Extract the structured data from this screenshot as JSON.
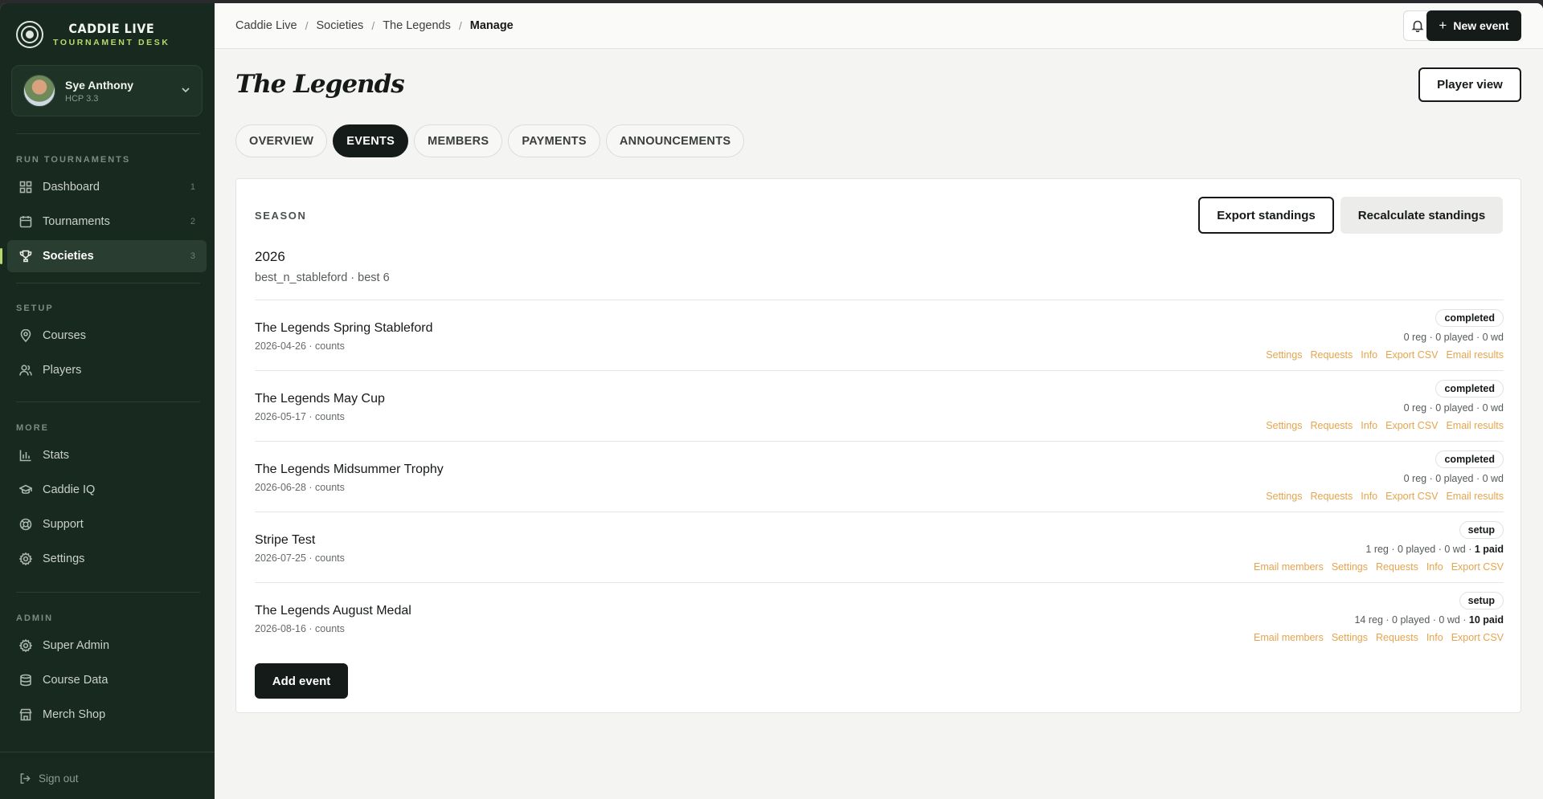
{
  "brand": {
    "title": "CADDIE LIVE",
    "subtitle": "TOURNAMENT DESK"
  },
  "user": {
    "name": "Sye Anthony",
    "hcp": "HCP 3.3"
  },
  "sidebar": {
    "sections": {
      "run": "RUN TOURNAMENTS",
      "setup": "SETUP",
      "more": "MORE",
      "admin": "ADMIN"
    },
    "items": [
      {
        "label": "Dashboard",
        "icon": "grid-icon",
        "count": "1"
      },
      {
        "label": "Tournaments",
        "icon": "calendar-icon",
        "count": "2"
      },
      {
        "label": "Societies",
        "icon": "trophy-icon",
        "count": "3",
        "active": true
      },
      {
        "label": "Courses",
        "icon": "map-pin-icon"
      },
      {
        "label": "Players",
        "icon": "users-icon"
      },
      {
        "label": "Stats",
        "icon": "bar-chart-icon"
      },
      {
        "label": "Caddie IQ",
        "icon": "graduation-cap-icon"
      },
      {
        "label": "Support",
        "icon": "lifebuoy-icon"
      },
      {
        "label": "Settings",
        "icon": "gear-icon"
      },
      {
        "label": "Super Admin",
        "icon": "gear-icon"
      },
      {
        "label": "Course Data",
        "icon": "database-icon"
      },
      {
        "label": "Merch Shop",
        "icon": "store-icon"
      }
    ],
    "signout": "Sign out"
  },
  "breadcrumb": [
    "Caddie Live",
    "Societies",
    "The Legends",
    "Manage"
  ],
  "header": {
    "new_event": "New event"
  },
  "page": {
    "title": "The Legends",
    "player_view": "Player view"
  },
  "tabs": [
    "OVERVIEW",
    "EVENTS",
    "MEMBERS",
    "PAYMENTS",
    "ANNOUNCEMENTS"
  ],
  "season": {
    "label": "SEASON",
    "year": "2026",
    "rule": "best_n_stableford · best 6",
    "export_label": "Export standings",
    "recalc_label": "Recalculate standings"
  },
  "events": [
    {
      "name": "The Legends Spring Stableford",
      "meta": "2026-04-26 · counts",
      "status": "completed",
      "stats": "0 reg · 0 played · 0 wd",
      "paid": "",
      "links": [
        "Settings",
        "Requests",
        "Info",
        "Export CSV",
        "Email results"
      ]
    },
    {
      "name": "The Legends May Cup",
      "meta": "2026-05-17 · counts",
      "status": "completed",
      "stats": "0 reg · 0 played · 0 wd",
      "paid": "",
      "links": [
        "Settings",
        "Requests",
        "Info",
        "Export CSV",
        "Email results"
      ]
    },
    {
      "name": "The Legends Midsummer Trophy",
      "meta": "2026-06-28 · counts",
      "status": "completed",
      "stats": "0 reg · 0 played · 0 wd",
      "paid": "",
      "links": [
        "Settings",
        "Requests",
        "Info",
        "Export CSV",
        "Email results"
      ]
    },
    {
      "name": "Stripe Test",
      "meta": "2026-07-25 · counts",
      "status": "setup",
      "stats": "1 reg · 0 played · 0 wd · ",
      "paid": "1 paid",
      "links": [
        "Email members",
        "Settings",
        "Requests",
        "Info",
        "Export CSV"
      ]
    },
    {
      "name": "The Legends August Medal",
      "meta": "2026-08-16 · counts",
      "status": "setup",
      "stats": "14 reg · 0 played · 0 wd · ",
      "paid": "10 paid",
      "links": [
        "Email members",
        "Settings",
        "Requests",
        "Info",
        "Export CSV"
      ]
    }
  ],
  "add_event": "Add event",
  "colors": {
    "sidebar": "#18291f",
    "accent": "#b8d96b",
    "link": "#e6a44d",
    "primary": "#151b18"
  }
}
